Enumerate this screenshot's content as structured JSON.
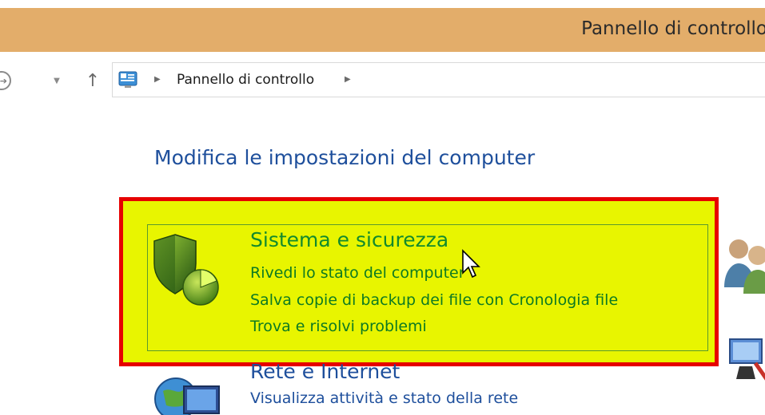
{
  "window": {
    "title": "Pannello di controllo"
  },
  "nav": {
    "back_icon": "back-arrow-icon",
    "dropdown_icon": "chevron-down-icon",
    "up_icon": "up-arrow-icon",
    "breadcrumb": {
      "icon": "control-panel-icon",
      "label": "Pannello di controllo"
    }
  },
  "main": {
    "heading": "Modifica le impostazioni del computer",
    "categories": [
      {
        "title": "Sistema e sicurezza",
        "icon": "shield-icon",
        "highlighted": true,
        "links": [
          "Rivedi lo stato del computer",
          "Salva copie di backup dei file con Cronologia file",
          "Trova e risolvi problemi"
        ]
      },
      {
        "title": "Rete e Internet",
        "icon": "globe-network-icon",
        "links": [
          "Visualizza attività e stato della rete"
        ]
      }
    ]
  },
  "colors": {
    "titlebar": "#e3ad6a",
    "highlight_fill": "#e8f500",
    "highlight_border": "#e60000",
    "category_title_green": "#128a2d",
    "heading_blue": "#1e4f9c"
  }
}
